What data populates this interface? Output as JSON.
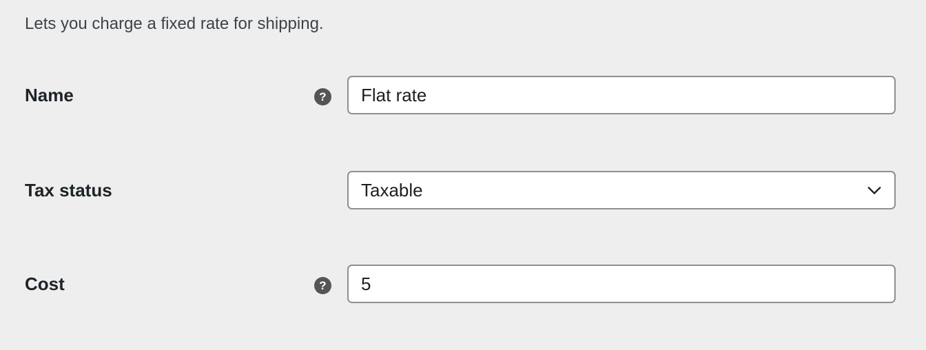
{
  "description": "Lets you charge a fixed rate for shipping.",
  "fields": {
    "name": {
      "label": "Name",
      "value": "Flat rate",
      "help_icon": "help-icon"
    },
    "tax_status": {
      "label": "Tax status",
      "selected": "Taxable",
      "icon": "chevron-down-icon"
    },
    "cost": {
      "label": "Cost",
      "value": "5",
      "help_icon": "help-icon"
    }
  },
  "help_glyph": "?",
  "colors": {
    "background": "#eeeeee",
    "field_border": "#8c8f94",
    "help_icon_bg": "#555555"
  }
}
